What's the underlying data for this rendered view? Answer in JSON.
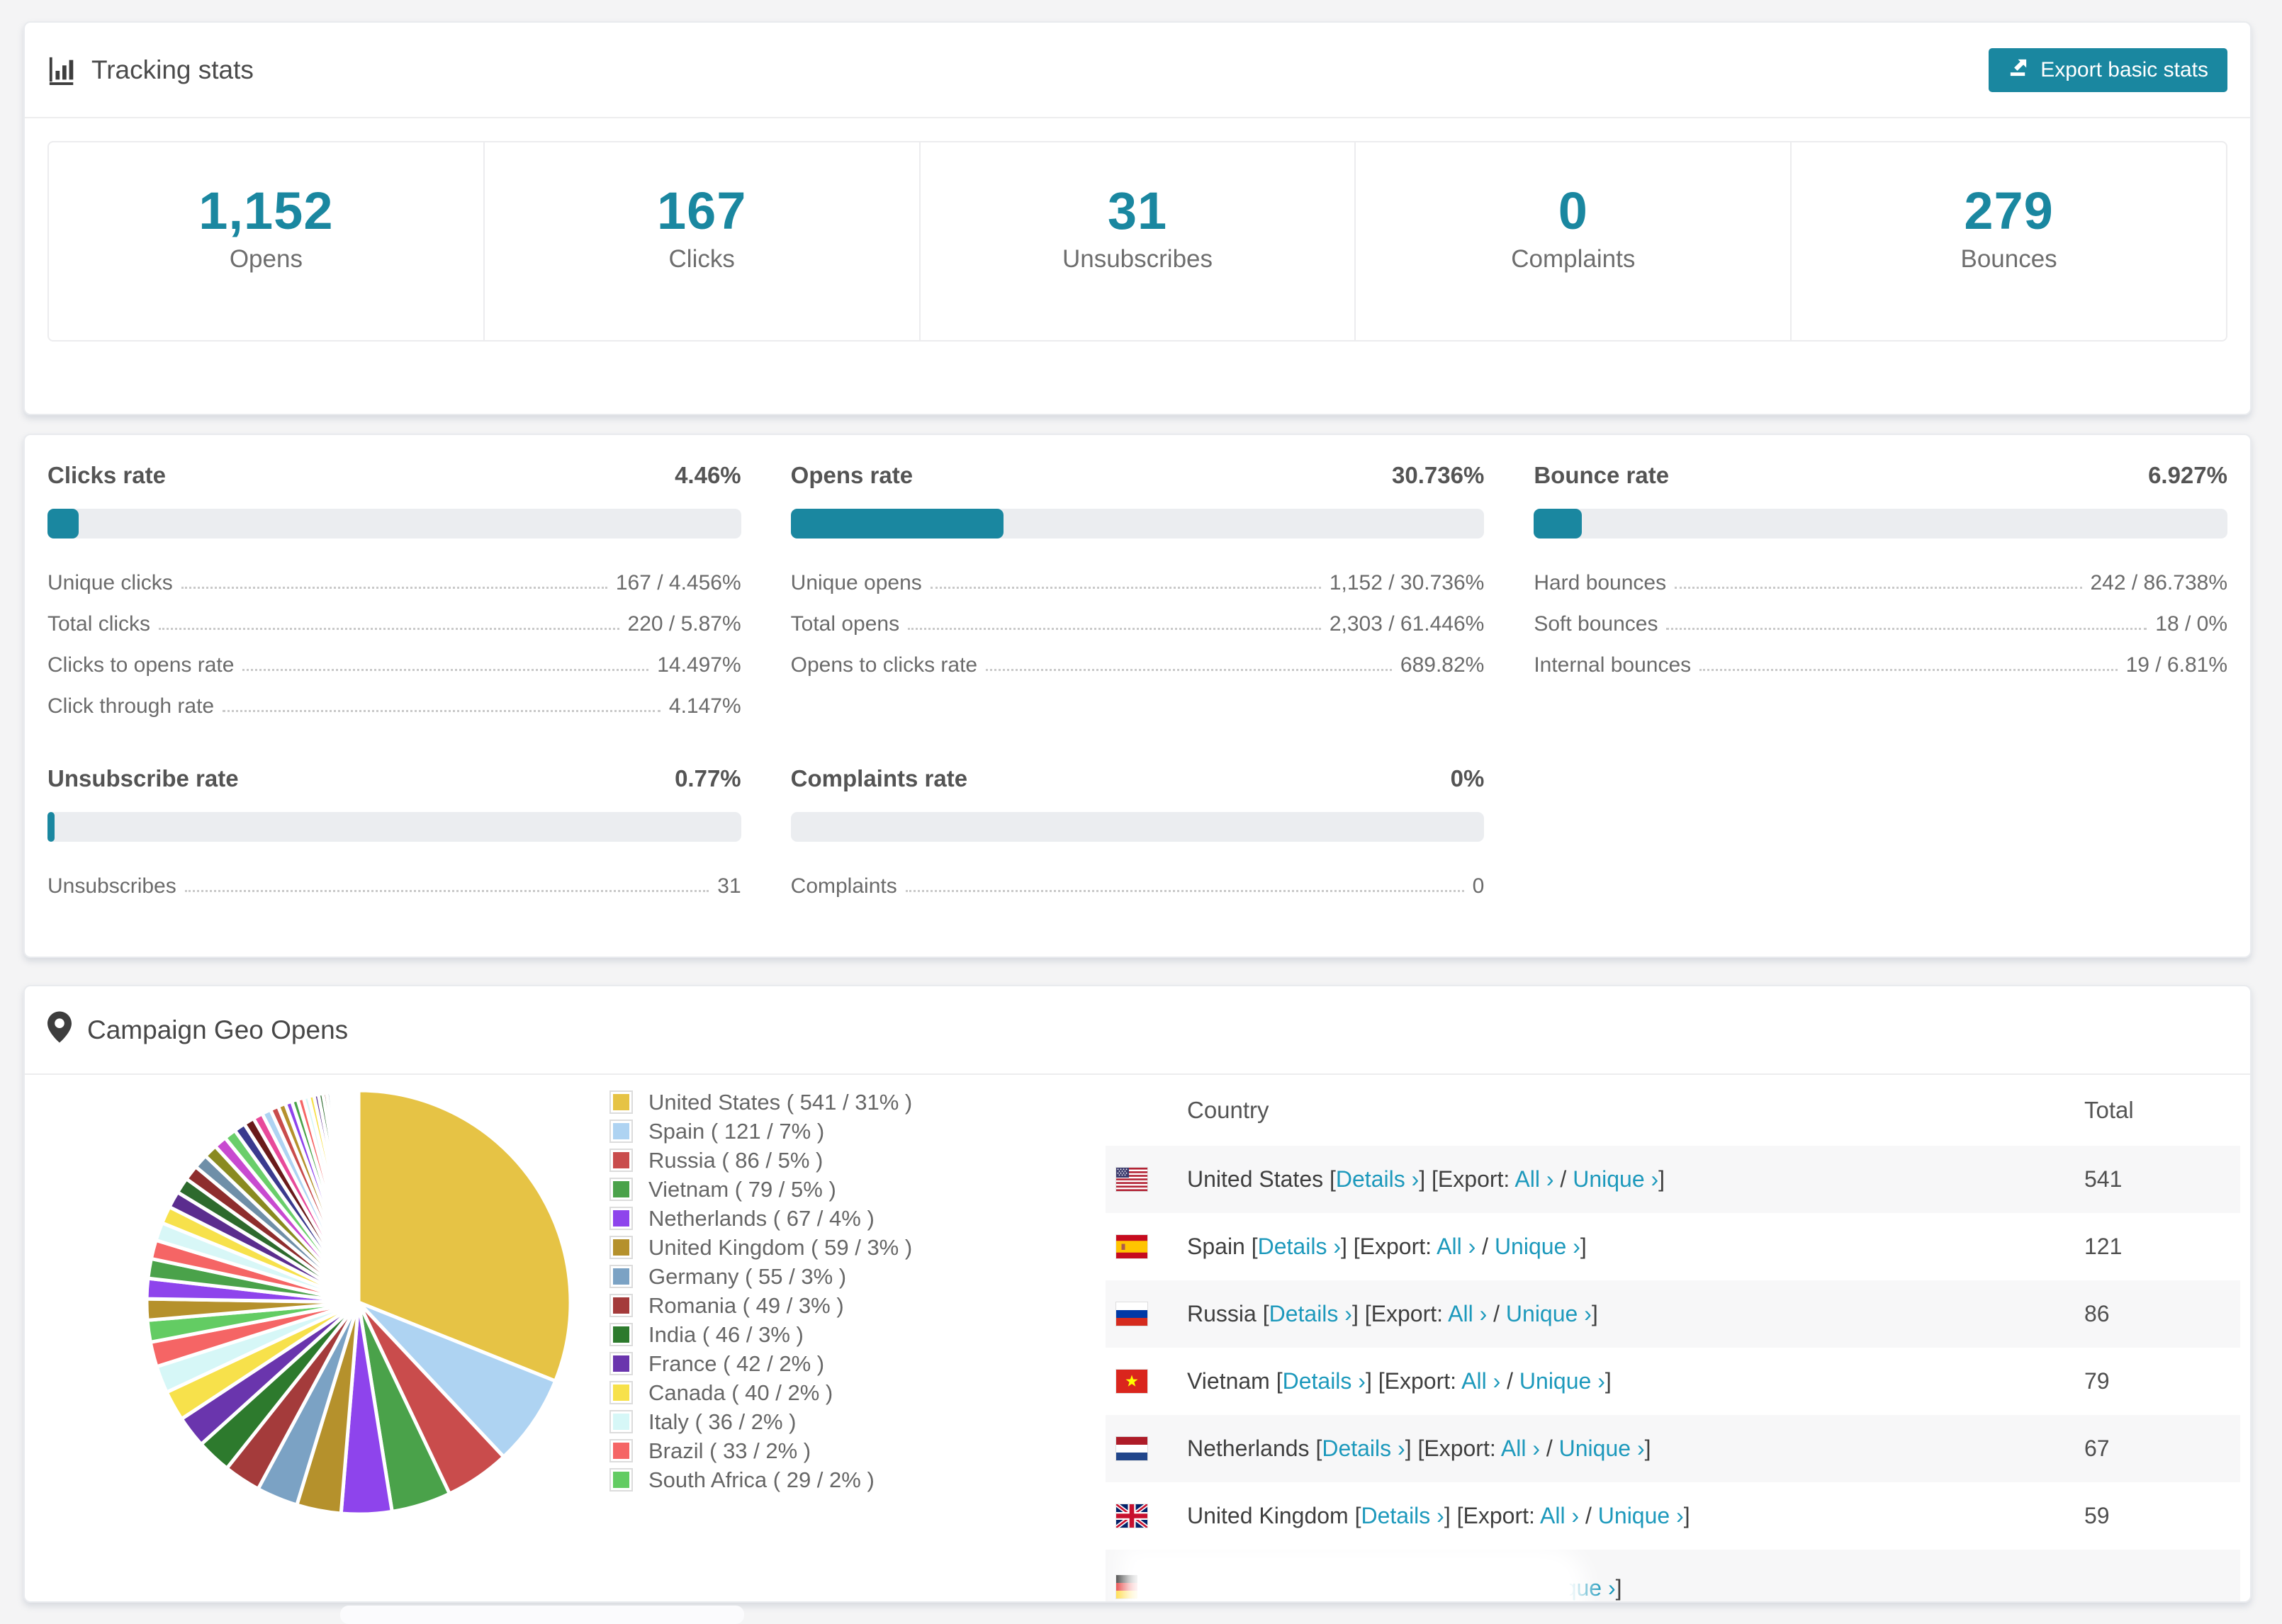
{
  "theme": {
    "accent": "#1a87a0",
    "link": "#1d99bc",
    "page_bg": "#f4f4f5"
  },
  "tracking": {
    "title": "Tracking stats",
    "export_button": "Export basic stats",
    "stats": [
      {
        "value": "1,152",
        "label": "Opens"
      },
      {
        "value": "167",
        "label": "Clicks"
      },
      {
        "value": "31",
        "label": "Unsubscribes"
      },
      {
        "value": "0",
        "label": "Complaints"
      },
      {
        "value": "279",
        "label": "Bounces"
      }
    ]
  },
  "rates": [
    {
      "title": "Clicks rate",
      "value": "4.46%",
      "percent": 4.46,
      "rows": [
        {
          "label": "Unique clicks",
          "value": "167 / 4.456%"
        },
        {
          "label": "Total clicks",
          "value": "220 / 5.87%"
        },
        {
          "label": "Clicks to opens rate",
          "value": "14.497%"
        },
        {
          "label": "Click through rate",
          "value": "4.147%"
        }
      ]
    },
    {
      "title": "Opens rate",
      "value": "30.736%",
      "percent": 30.736,
      "rows": [
        {
          "label": "Unique opens",
          "value": "1,152 / 30.736%"
        },
        {
          "label": "Total opens",
          "value": "2,303 / 61.446%"
        },
        {
          "label": "Opens to clicks rate",
          "value": "689.82%"
        }
      ]
    },
    {
      "title": "Bounce rate",
      "value": "6.927%",
      "percent": 6.927,
      "rows": [
        {
          "label": "Hard bounces",
          "value": "242 / 86.738%"
        },
        {
          "label": "Soft bounces",
          "value": "18 / 0%"
        },
        {
          "label": "Internal bounces",
          "value": "19 / 6.81%"
        }
      ]
    },
    {
      "title": "Unsubscribe rate",
      "value": "0.77%",
      "percent": 0.77,
      "rows": [
        {
          "label": "Unsubscribes",
          "value": "31"
        }
      ]
    },
    {
      "title": "Complaints rate",
      "value": "0%",
      "percent": 0,
      "rows": [
        {
          "label": "Complaints",
          "value": "0"
        }
      ]
    }
  ],
  "geo": {
    "title": "Campaign Geo Opens",
    "table": {
      "headers": [
        "Country",
        "Total"
      ],
      "link_labels": {
        "details": "Details ›",
        "export_prefix": "Export:",
        "all": "All ›",
        "unique": "Unique ›"
      },
      "rows": [
        {
          "flag": "us",
          "country": "United States",
          "total": "541"
        },
        {
          "flag": "es",
          "country": "Spain",
          "total": "121"
        },
        {
          "flag": "ru",
          "country": "Russia",
          "total": "86"
        },
        {
          "flag": "vn",
          "country": "Vietnam",
          "total": "79"
        },
        {
          "flag": "nl",
          "country": "Netherlands",
          "total": "67"
        },
        {
          "flag": "gb",
          "country": "United Kingdom",
          "total": "59"
        },
        {
          "flag": "de",
          "country": "Germany",
          "total": "",
          "partial": true
        }
      ]
    }
  },
  "chart_data": {
    "type": "pie",
    "title": "Campaign Geo Opens",
    "legend_position": "right",
    "legend_format": "{label} ( {value} / {percent}% )",
    "labels": [
      "United States",
      "Spain",
      "Russia",
      "Vietnam",
      "Netherlands",
      "United Kingdom",
      "Germany",
      "Romania",
      "India",
      "France",
      "Canada",
      "Italy",
      "Brazil",
      "South Africa"
    ],
    "values": [
      541,
      121,
      86,
      79,
      67,
      59,
      55,
      49,
      46,
      42,
      40,
      36,
      33,
      29
    ],
    "percents": [
      31,
      7,
      5,
      5,
      4,
      3,
      3,
      3,
      3,
      2,
      2,
      2,
      2,
      2
    ],
    "colors": [
      "#e6c345",
      "#aed3f2",
      "#c94c4c",
      "#4aa24a",
      "#8e44ec",
      "#b5912c",
      "#7ba2c4",
      "#a43b3b",
      "#2d7a2d",
      "#6a35ad",
      "#f7e14b",
      "#d6f7f7",
      "#f56565",
      "#63cc63"
    ],
    "other_slices": {
      "values": [
        28,
        27,
        26,
        25,
        24,
        23,
        22,
        21,
        20,
        19,
        18,
        17,
        16,
        15,
        14,
        13,
        12,
        11,
        10,
        9,
        8,
        8,
        7,
        7,
        6,
        6,
        5,
        5,
        4,
        4,
        3,
        3,
        3,
        2,
        2,
        2,
        2,
        2,
        1,
        1,
        1,
        1,
        1,
        1,
        1,
        1,
        1,
        1
      ],
      "palette": [
        "#b5912c",
        "#8e44ec",
        "#4aa24a",
        "#f56565",
        "#d8f7f7",
        "#f7e14b",
        "#5b2d8e",
        "#2d6a2d",
        "#8e2d2d",
        "#6f8fa8",
        "#8a8a20",
        "#c84ad0",
        "#6ace6a",
        "#3a3a8e",
        "#6a1a1a",
        "#e84a9a",
        "#aed3f2",
        "#c94c4c"
      ]
    }
  }
}
